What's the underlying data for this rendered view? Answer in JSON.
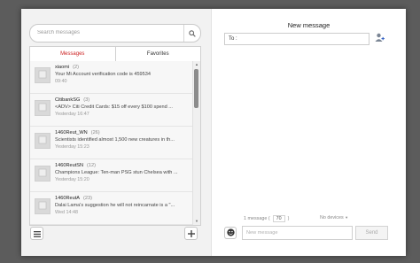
{
  "search": {
    "placeholder": "Search messages"
  },
  "tabs": [
    {
      "label": "Messages",
      "active": true
    },
    {
      "label": "Favorites",
      "active": false
    }
  ],
  "conversations": [
    {
      "sender": "xiaomi",
      "count": "(2)",
      "preview": "Your Mi Account verification code is 459534",
      "time": "09:40"
    },
    {
      "sender": "CitibankSG",
      "count": "(3)",
      "preview": "<ADV> Citi Credit Cards: $15 off every $100 spend ...",
      "time": "Yesterday 16:47"
    },
    {
      "sender": "1460Reut_WN",
      "count": "(26)",
      "preview": "Scientists identified almost 1,500 new creatures in th...",
      "time": "Yesterday 15:23"
    },
    {
      "sender": "1460ReutSN",
      "count": "(12)",
      "preview": "Champions League: Ten-man PSG stun Chelsea with ...",
      "time": "Yesterday 15:20"
    },
    {
      "sender": "1460ReutA",
      "count": "(23)",
      "preview": "Dalai Lama's suggestion he will not reincarnate is a \"...",
      "time": "Wed 14:48"
    }
  ],
  "compose": {
    "title": "New message",
    "to_label": "To :",
    "message_count_prefix": "1 message (",
    "char_count": "70",
    "message_count_suffix": ")",
    "devices": "No devices",
    "input_placeholder": "New message",
    "send_label": "Send"
  },
  "colors": {
    "active_tab": "#cc2222",
    "window_bg": "#ffffff",
    "left_pane_bg": "#f2f2f2"
  },
  "icons": [
    "search-icon",
    "menu-icon",
    "plus-icon",
    "add-contact-icon",
    "emoji-icon",
    "avatar-placeholder-icon"
  ]
}
